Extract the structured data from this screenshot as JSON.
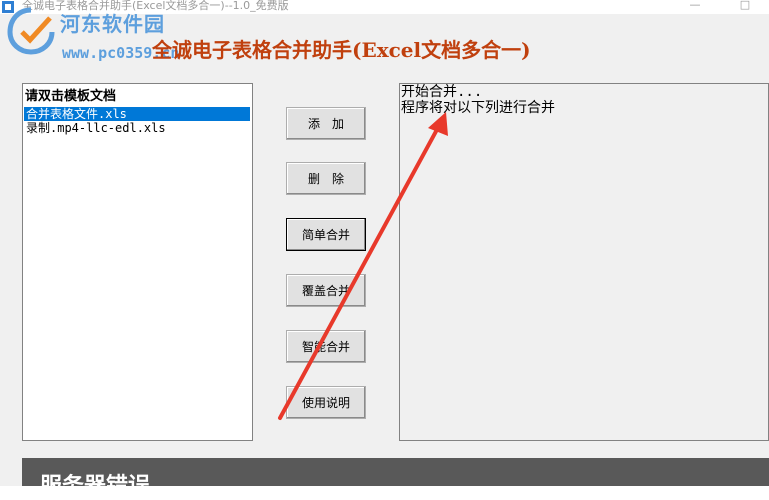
{
  "window": {
    "title": "全诚电子表格合并助手(Excel文档多合一)--1.0_免费版",
    "minimize_glyph": "—",
    "maximize_glyph": "□"
  },
  "watermark": {
    "site_name": "河东软件园",
    "url": "www.pc0359.cn"
  },
  "app": {
    "heading": "全诚电子表格合并助手(Excel文档多合一)"
  },
  "file_list": {
    "header": "请双击模板文档",
    "items": [
      {
        "label": "合并表格文件.xls",
        "selected": true
      },
      {
        "label": "录制.mp4-llc-edl.xls",
        "selected": false
      }
    ]
  },
  "buttons": {
    "add": "添　加",
    "delete": "删　除",
    "simple_merge": "简单合并",
    "overwrite_merge": "覆盖合并",
    "smart_merge": "智能合并",
    "instructions": "使用说明"
  },
  "output": {
    "lines": [
      "开始合并...",
      "程序将对以下列进行合并"
    ]
  },
  "error_banner": {
    "text": "服务器错误"
  },
  "colors": {
    "heading": "#c0400e",
    "selection": "#0078d7",
    "annotation_arrow": "#e8392b",
    "watermark": "#5d9fdd"
  }
}
